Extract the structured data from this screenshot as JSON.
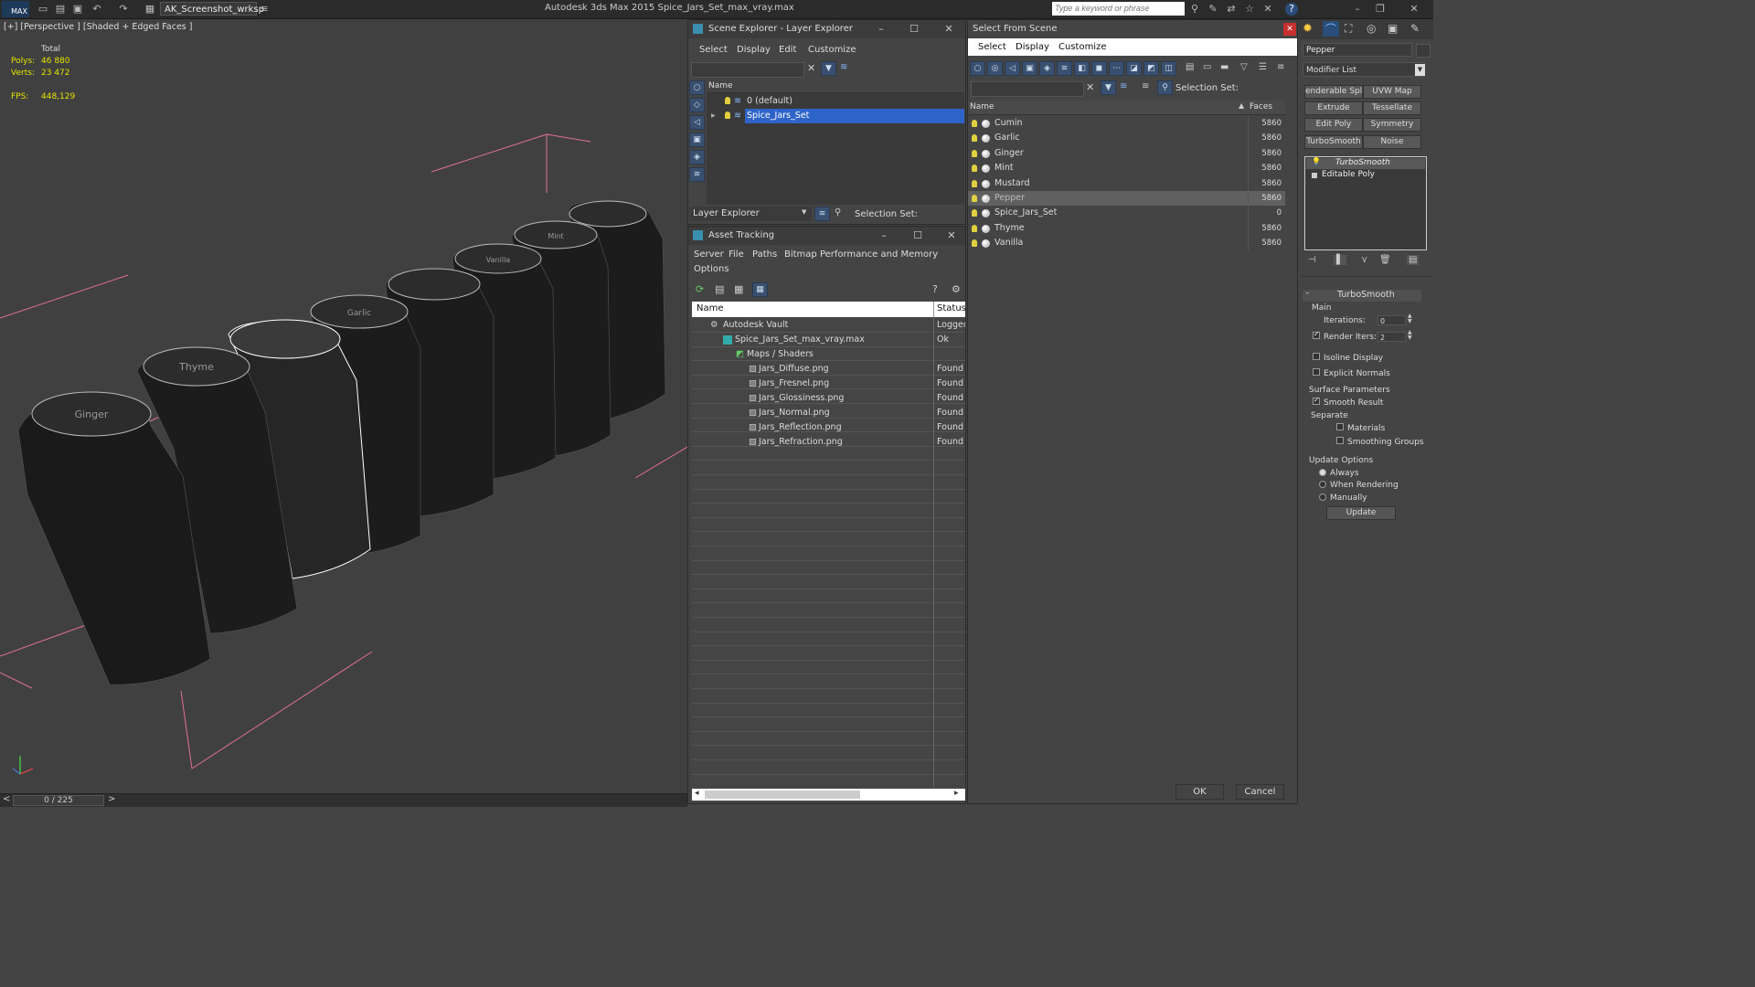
{
  "titlebar": {
    "logo": "MAX",
    "workspace": "AK_Screenshot_wrksp",
    "app_title": "Autodesk 3ds Max  2015    Spice_Jars_Set_max_vray.max",
    "search_placeholder": "Type a keyword or phrase"
  },
  "viewport": {
    "label": "[+] [Perspective ] [Shaded + Edged Faces ]",
    "stats": {
      "total_label": "Total",
      "polys_label": "Polys:",
      "polys_value": "46 880",
      "verts_label": "Verts:",
      "verts_value": "23 472",
      "fps_label": "FPS:",
      "fps_value": "448,129"
    },
    "jar_labels": [
      "Ginger",
      "Thyme",
      "Garlic",
      "Vanilla",
      "Mint"
    ]
  },
  "timeline": {
    "frame": "0 / 225",
    "prev": "<",
    "next": ">"
  },
  "scene_explorer": {
    "title": "Scene Explorer - Layer Explorer",
    "menu": [
      "Select",
      "Display",
      "Edit",
      "Customize"
    ],
    "column": "Name",
    "layers": [
      "0 (default)",
      "Spice_Jars_Set"
    ],
    "footer_dropdown": "Layer Explorer",
    "selection_set_label": "Selection Set:"
  },
  "asset_tracking": {
    "title": "Asset Tracking",
    "menu": [
      "Server",
      "File",
      "Paths",
      "Bitmap Performance and Memory",
      "Options"
    ],
    "columns": [
      "Name",
      "Status"
    ],
    "rows": [
      {
        "name": "Autodesk Vault",
        "status": "Logged"
      },
      {
        "name": "Spice_Jars_Set_max_vray.max",
        "status": "Ok"
      },
      {
        "name": "Maps / Shaders",
        "status": ""
      },
      {
        "name": "Jars_Diffuse.png",
        "status": "Found"
      },
      {
        "name": "Jars_Fresnel.png",
        "status": "Found"
      },
      {
        "name": "Jars_Glossiness.png",
        "status": "Found"
      },
      {
        "name": "Jars_Normal.png",
        "status": "Found"
      },
      {
        "name": "Jars_Reflection.png",
        "status": "Found"
      },
      {
        "name": "Jars_Refraction.png",
        "status": "Found"
      }
    ]
  },
  "select_from_scene": {
    "title": "Select From Scene",
    "menu": [
      "Select",
      "Display",
      "Customize"
    ],
    "selection_set_label": "Selection Set:",
    "columns": [
      "Name",
      "Faces"
    ],
    "objects": [
      {
        "name": "Cumin",
        "faces": "5860"
      },
      {
        "name": "Garlic",
        "faces": "5860"
      },
      {
        "name": "Ginger",
        "faces": "5860"
      },
      {
        "name": "Mint",
        "faces": "5860"
      },
      {
        "name": "Mustard",
        "faces": "5860"
      },
      {
        "name": "Pepper",
        "faces": "5860"
      },
      {
        "name": "Spice_Jars_Set",
        "faces": "0"
      },
      {
        "name": "Thyme",
        "faces": "5860"
      },
      {
        "name": "Vanilla",
        "faces": "5860"
      }
    ],
    "selected": "Pepper",
    "ok": "OK",
    "cancel": "Cancel"
  },
  "command_panel": {
    "object_name": "Pepper",
    "modifier_list": "Modifier List",
    "buttons": [
      "enderable Spli",
      "UVW Map",
      "Extrude",
      "Tessellate",
      "Edit Poly",
      "Symmetry",
      "TurboSmooth",
      "Noise"
    ],
    "stack": [
      "TurboSmooth",
      "Editable Poly"
    ],
    "rollout_title": "TurboSmooth",
    "main_label": "Main",
    "iterations_label": "Iterations:",
    "iterations_value": "0",
    "render_iters_label": "Render Iters:",
    "render_iters_value": "2",
    "isoline_label": "Isoline Display",
    "explicit_normals_label": "Explicit Normals",
    "surface_params_label": "Surface Parameters",
    "smooth_result_label": "Smooth Result",
    "separate_label": "Separate",
    "materials_label": "Materials",
    "smoothing_groups_label": "Smoothing Groups",
    "update_options_label": "Update Options",
    "always_label": "Always",
    "when_rendering_label": "When Rendering",
    "manually_label": "Manually",
    "update_button": "Update"
  }
}
